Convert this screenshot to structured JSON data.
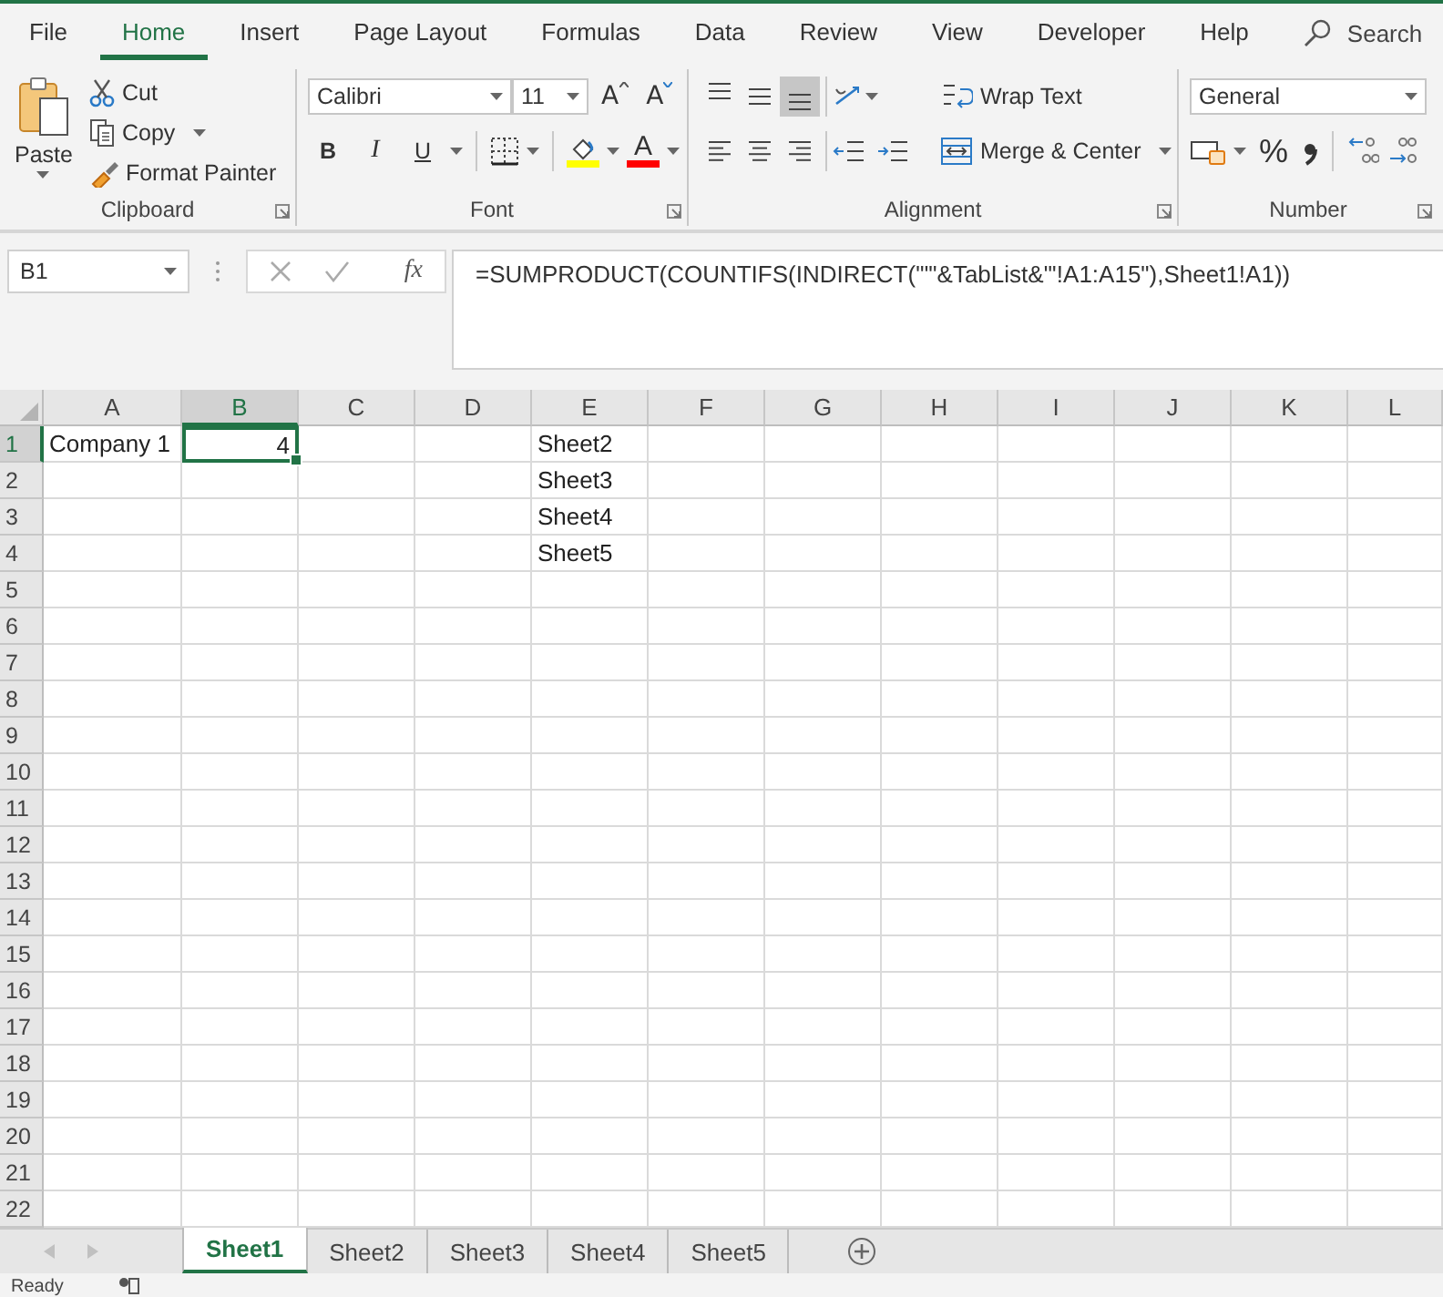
{
  "menu_tabs": [
    {
      "label": "File",
      "selected": false
    },
    {
      "label": "Home",
      "selected": true
    },
    {
      "label": "Insert",
      "selected": false
    },
    {
      "label": "Page Layout",
      "selected": false
    },
    {
      "label": "Formulas",
      "selected": false
    },
    {
      "label": "Data",
      "selected": false
    },
    {
      "label": "Review",
      "selected": false
    },
    {
      "label": "View",
      "selected": false
    },
    {
      "label": "Developer",
      "selected": false
    },
    {
      "label": "Help",
      "selected": false
    }
  ],
  "search": {
    "label": "Search"
  },
  "clipboard": {
    "title": "Clipboard",
    "paste": "Paste",
    "cut": "Cut",
    "copy": "Copy",
    "format_painter": "Format Painter"
  },
  "font": {
    "title": "Font",
    "font_name": "Calibri",
    "font_size": "11",
    "grow_font": "A",
    "shrink_font": "A",
    "bold": "B",
    "italic": "I",
    "underline": "U",
    "font_color": "A"
  },
  "alignment": {
    "title": "Alignment",
    "vertical_align": [
      {
        "kind": "top",
        "selected": false
      },
      {
        "kind": "middle",
        "selected": false
      },
      {
        "kind": "bottom",
        "selected": true
      }
    ],
    "horizontal_align": [
      {
        "kind": "left",
        "selected": false
      },
      {
        "kind": "center",
        "selected": false
      },
      {
        "kind": "right",
        "selected": false
      }
    ],
    "wrap_text": "Wrap Text",
    "merge_center": "Merge & Center"
  },
  "number": {
    "title": "Number",
    "format": "General",
    "percent": "%"
  },
  "formula_bar": {
    "name_box": "B1",
    "fx": "fx",
    "formula": "=SUMPRODUCT(COUNTIFS(INDIRECT(\"'\"&TabList&\"'!A1:A15\"),Sheet1!A1))"
  },
  "columns": [
    {
      "label": "A",
      "selected": false
    },
    {
      "label": "B",
      "selected": true
    },
    {
      "label": "C",
      "selected": false
    },
    {
      "label": "D",
      "selected": false
    },
    {
      "label": "E",
      "selected": false
    },
    {
      "label": "F",
      "selected": false
    },
    {
      "label": "G",
      "selected": false
    },
    {
      "label": "H",
      "selected": false
    },
    {
      "label": "I",
      "selected": false
    },
    {
      "label": "J",
      "selected": false
    },
    {
      "label": "K",
      "selected": false
    },
    {
      "label": "L",
      "selected": false
    }
  ],
  "rows": [
    {
      "header": "1",
      "selected": true,
      "cells": [
        {
          "value": "Company 1",
          "kind": "text",
          "selected": false
        },
        {
          "value": "4",
          "kind": "number",
          "selected": true
        },
        null,
        null,
        {
          "value": "Sheet2",
          "kind": "text",
          "selected": false
        }
      ]
    },
    {
      "header": "2",
      "selected": false,
      "cells": [
        null,
        null,
        null,
        null,
        {
          "value": "Sheet3",
          "kind": "text",
          "selected": false
        }
      ]
    },
    {
      "header": "3",
      "selected": false,
      "cells": [
        null,
        null,
        null,
        null,
        {
          "value": "Sheet4",
          "kind": "text",
          "selected": false
        }
      ]
    },
    {
      "header": "4",
      "selected": false,
      "cells": [
        null,
        null,
        null,
        null,
        {
          "value": "Sheet5",
          "kind": "text",
          "selected": false
        }
      ]
    },
    {
      "header": "5",
      "selected": false
    },
    {
      "header": "6",
      "selected": false
    },
    {
      "header": "7",
      "selected": false
    },
    {
      "header": "8",
      "selected": false
    },
    {
      "header": "9",
      "selected": false
    },
    {
      "header": "10",
      "selected": false
    },
    {
      "header": "11",
      "selected": false
    },
    {
      "header": "12",
      "selected": false
    },
    {
      "header": "13",
      "selected": false
    },
    {
      "header": "14",
      "selected": false
    },
    {
      "header": "15",
      "selected": false
    },
    {
      "header": "16",
      "selected": false
    },
    {
      "header": "17",
      "selected": false
    },
    {
      "header": "18",
      "selected": false
    },
    {
      "header": "19",
      "selected": false
    },
    {
      "header": "20",
      "selected": false
    },
    {
      "header": "21",
      "selected": false
    },
    {
      "header": "22",
      "selected": false
    }
  ],
  "sheet_tabs": [
    {
      "label": "Sheet1",
      "selected": true
    },
    {
      "label": "Sheet2",
      "selected": false
    },
    {
      "label": "Sheet3",
      "selected": false
    },
    {
      "label": "Sheet4",
      "selected": false
    },
    {
      "label": "Sheet5",
      "selected": false
    }
  ],
  "status_bar": {
    "text": "Ready"
  }
}
